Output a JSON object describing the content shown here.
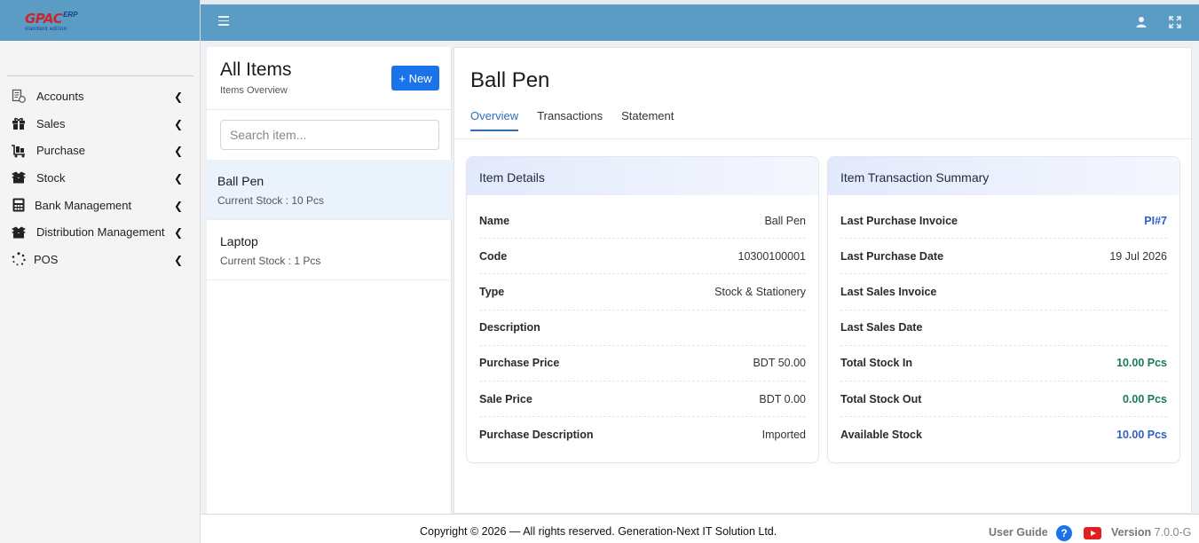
{
  "brand": {
    "logo_main": "GPAC",
    "logo_erp": "ERP",
    "logo_sub": "standard edition"
  },
  "sidebar": {
    "items": [
      {
        "label": "Accounts",
        "icon": "ledger-icon"
      },
      {
        "label": "Sales",
        "icon": "gift-icon"
      },
      {
        "label": "Purchase",
        "icon": "cart-icon"
      },
      {
        "label": "Stock",
        "icon": "box-icon"
      },
      {
        "label": "Bank Management",
        "icon": "calculator-icon"
      },
      {
        "label": "Distribution Management",
        "icon": "box-icon"
      },
      {
        "label": "POS",
        "icon": "spinner-icon"
      }
    ]
  },
  "list": {
    "title": "All Items",
    "subtitle": "Items Overview",
    "new_label": "+ New",
    "search_placeholder": "Search item...",
    "items": [
      {
        "name": "Ball Pen",
        "stock": "Current Stock : 10 Pcs"
      },
      {
        "name": "Laptop",
        "stock": "Current Stock : 1 Pcs"
      }
    ]
  },
  "detail": {
    "title": "Ball Pen",
    "tabs": [
      "Overview",
      "Transactions",
      "Statement"
    ],
    "details_card": {
      "title": "Item Details",
      "rows": [
        {
          "k": "Name",
          "v": "Ball Pen"
        },
        {
          "k": "Code",
          "v": "10300100001"
        },
        {
          "k": "Type",
          "v": "Stock & Stationery"
        },
        {
          "k": "Description",
          "v": ""
        },
        {
          "k": "Purchase Price",
          "v": "BDT 50.00"
        },
        {
          "k": "Sale Price",
          "v": "BDT 0.00"
        },
        {
          "k": "Purchase Description",
          "v": "Imported"
        }
      ]
    },
    "summary_card": {
      "title": "Item Transaction Summary",
      "rows": [
        {
          "k": "Last Purchase Invoice",
          "v": "PI#7"
        },
        {
          "k": "Last Purchase Date",
          "v": "19 Jul 2026"
        },
        {
          "k": "Last Sales Invoice",
          "v": ""
        },
        {
          "k": "Last Sales Date",
          "v": ""
        },
        {
          "k": "Total Stock In",
          "v": "10.00 Pcs"
        },
        {
          "k": "Total Stock Out",
          "v": "0.00 Pcs"
        },
        {
          "k": "Available Stock",
          "v": "10.00 Pcs"
        }
      ]
    }
  },
  "footer": {
    "copyright": "Copyright © 2026 — All rights reserved. Generation-Next IT Solution Ltd.",
    "guide": "User Guide",
    "version_label": "Version",
    "version": "7.0.0-G"
  },
  "colors": {
    "header": "#5b9cc4",
    "accent": "#1a73e8",
    "green_value": "#1a7a5e",
    "blue_value": "#2f5fc7"
  }
}
